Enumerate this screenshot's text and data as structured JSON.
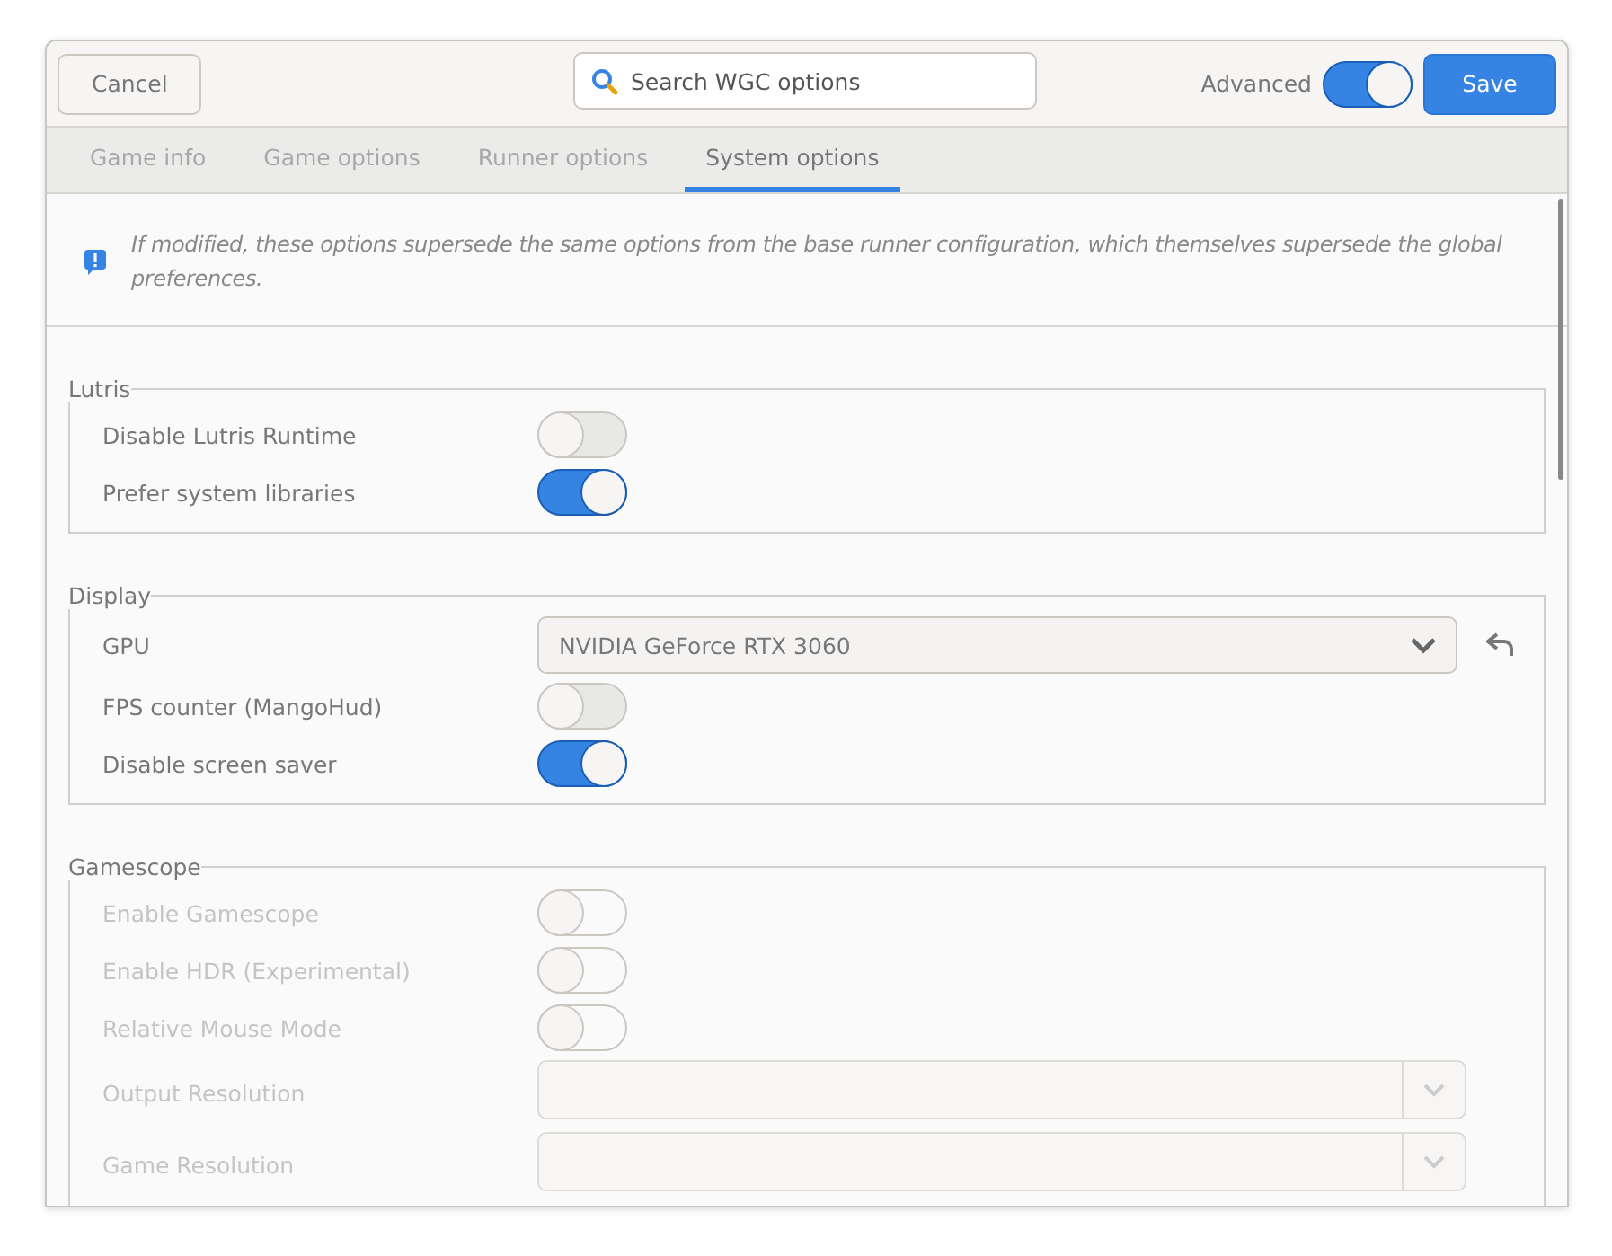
{
  "header": {
    "cancel": "Cancel",
    "search_placeholder": "Search WGC options",
    "advanced_label": "Advanced",
    "advanced_on": true,
    "save": "Save"
  },
  "tabs": [
    {
      "label": "Game info",
      "selected": false
    },
    {
      "label": "Game options",
      "selected": false
    },
    {
      "label": "Runner options",
      "selected": false
    },
    {
      "label": "System options",
      "selected": true
    }
  ],
  "notice": "If modified, these options supersede the same options from the base runner configuration, which themselves supersede the global preferences.",
  "sections": [
    {
      "title": "Lutris",
      "disabled": false,
      "rows": [
        {
          "kind": "toggle",
          "label": "Disable Lutris Runtime",
          "on": false
        },
        {
          "kind": "toggle",
          "label": "Prefer system libraries",
          "on": true
        }
      ]
    },
    {
      "title": "Display",
      "disabled": false,
      "rows": [
        {
          "kind": "select",
          "label": "GPU",
          "value": "NVIDIA GeForce RTX 3060"
        },
        {
          "kind": "toggle",
          "label": "FPS counter (MangoHud)",
          "on": false
        },
        {
          "kind": "toggle",
          "label": "Disable screen saver",
          "on": true
        }
      ]
    },
    {
      "title": "Gamescope",
      "disabled": true,
      "rows": [
        {
          "kind": "toggle",
          "label": "Enable Gamescope",
          "on": false
        },
        {
          "kind": "toggle",
          "label": "Enable HDR (Experimental)",
          "on": false
        },
        {
          "kind": "toggle",
          "label": "Relative Mouse Mode",
          "on": false
        },
        {
          "kind": "combo",
          "label": "Output Resolution"
        },
        {
          "kind": "combo",
          "label": "Game Resolution"
        }
      ]
    }
  ]
}
